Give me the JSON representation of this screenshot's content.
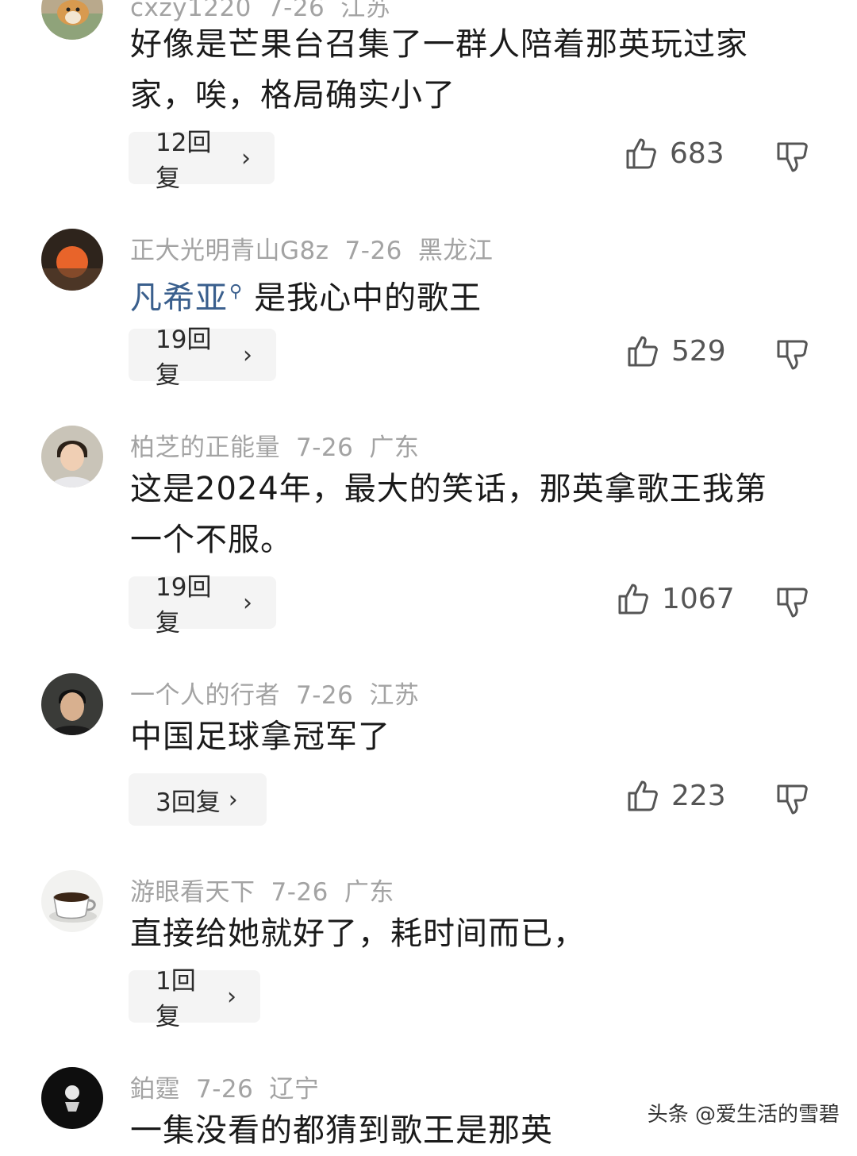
{
  "comments": [
    {
      "username": "cxzy1220",
      "date": "7-26",
      "location": "江苏",
      "text_line1": "好像是芒果台召集了一群人陪着那英玩过家",
      "text_line2": "家，唉，格局确实小了",
      "reply_label": "12回复",
      "likes": "683",
      "avatar_icon": "dog-avatar"
    },
    {
      "username": "正大光明青山G8z",
      "date": "7-26",
      "location": "黑龙江",
      "mention": "凡希亚",
      "mention_icon": "search-icon",
      "text_line1": "是我心中的歌王",
      "reply_label": "19回复",
      "likes": "529",
      "avatar_icon": "sunset-avatar"
    },
    {
      "username": "柏芝的正能量",
      "date": "7-26",
      "location": "广东",
      "text_line1": "这是2024年，最大的笑话，那英拿歌王我第",
      "text_line2": "一个不服。",
      "reply_label": "19回复",
      "likes": "1067",
      "avatar_icon": "person-avatar"
    },
    {
      "username": "一个人的行者",
      "date": "7-26",
      "location": "江苏",
      "text_line1": "中国足球拿冠军了",
      "reply_label": "3回复",
      "likes": "223",
      "avatar_icon": "person-avatar"
    },
    {
      "username": "游眼看天下",
      "date": "7-26",
      "location": "广东",
      "text_line1": "直接给她就好了，耗时间而已，",
      "reply_label": "1回复",
      "avatar_icon": "coffee-cup-avatar"
    },
    {
      "username": "鉑霆",
      "date": "7-26",
      "location": "辽宁",
      "text_line1": "一集没看的都猜到歌王是那英",
      "avatar_icon": "dark-logo-avatar"
    }
  ],
  "reply_chevron": "›",
  "watermark": "头条 @爱生活的雪碧",
  "colors": {
    "meta": "#a3a3a3",
    "mention": "#3a5f8d",
    "reply_bg": "#f4f4f4"
  }
}
